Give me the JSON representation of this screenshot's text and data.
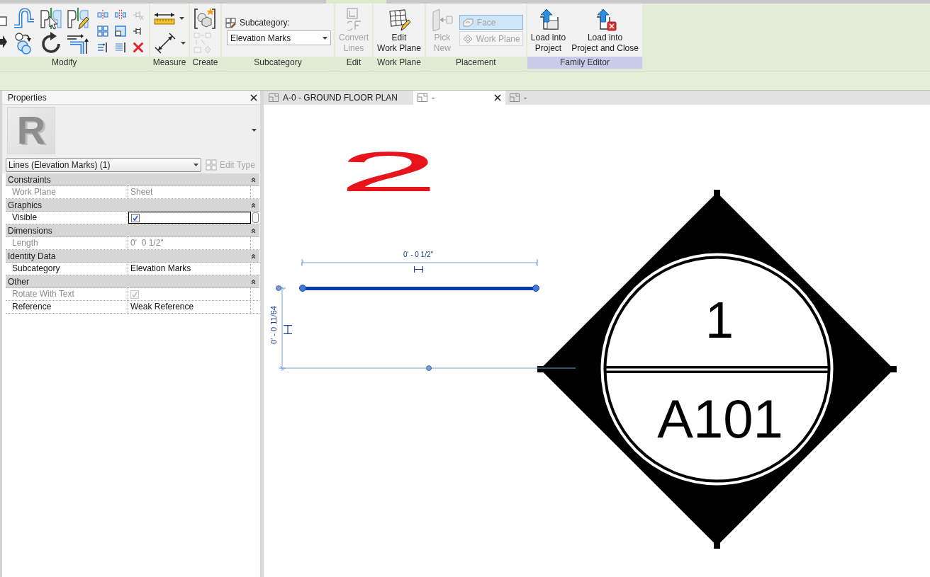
{
  "ribbon": {
    "panels": [
      {
        "kind": "modify",
        "label": "Modify",
        "highlighted": false,
        "large_tools": [
          {
            "kind": "align",
            "disabled": false
          },
          {
            "kind": "offset",
            "disabled": false
          },
          {
            "kind": "mirror_pick",
            "disabled": false
          },
          {
            "kind": "mirror_draw",
            "disabled": false
          },
          {
            "kind": "move",
            "disabled": false
          },
          {
            "kind": "copy",
            "disabled": false
          },
          {
            "kind": "rotate",
            "disabled": false
          },
          {
            "kind": "trim",
            "disabled": false
          }
        ],
        "small_tools": [
          {
            "kind": "split",
            "disabled": false
          },
          {
            "kind": "split_gap",
            "disabled": false
          },
          {
            "kind": "unpin",
            "disabled": true
          },
          {
            "kind": "array",
            "disabled": false
          },
          {
            "kind": "scale",
            "disabled": false
          },
          {
            "kind": "pin",
            "disabled": false
          },
          {
            "kind": "trim_multiple",
            "disabled": false
          },
          {
            "kind": "trim_single",
            "disabled": false
          },
          {
            "kind": "delete",
            "disabled": false
          }
        ]
      },
      {
        "kind": "measure",
        "label": "Measure",
        "highlighted": false,
        "tools": [
          {
            "kind": "aligned_dimension",
            "disabled": false
          },
          {
            "kind": "measure_between",
            "disabled": false
          }
        ]
      },
      {
        "kind": "create",
        "label": "Create",
        "highlighted": false,
        "tools": [
          {
            "kind": "group",
            "disabled": false
          },
          {
            "kind": "arrange",
            "disabled": true
          }
        ]
      },
      {
        "kind": "subcategory",
        "label": "Subcategory",
        "highlighted": false,
        "field_label": "Subcategory:",
        "value": "Elevation Marks"
      },
      {
        "kind": "buttons",
        "label": "Edit",
        "highlighted": false,
        "buttons": [
          {
            "kind": "convert_lines",
            "label": "Convert\nLines",
            "disabled": true
          }
        ]
      },
      {
        "kind": "buttons",
        "label": "Work Plane",
        "highlighted": false,
        "buttons": [
          {
            "kind": "edit_work_plane",
            "label": "Edit\nWork Plane",
            "disabled": false
          }
        ]
      },
      {
        "kind": "placement",
        "label": "Placement",
        "highlighted": false,
        "buttons": [
          {
            "kind": "pick_new",
            "label": "Pick\nNew",
            "disabled": true
          }
        ],
        "toggles": [
          {
            "kind": "face",
            "label": "Face",
            "selected": true,
            "disabled": true
          },
          {
            "kind": "work_plane",
            "label": "Work Plane",
            "selected": false,
            "disabled": true
          }
        ]
      },
      {
        "kind": "buttons",
        "label": "Family Editor",
        "highlighted": true,
        "buttons": [
          {
            "kind": "load",
            "label": "Load into\nProject",
            "disabled": false
          },
          {
            "kind": "load_close",
            "label": "Load into\nProject and Close",
            "disabled": false
          }
        ]
      }
    ]
  },
  "properties": {
    "title": "Properties",
    "logo": "R",
    "type_selector": "Lines (Elevation Marks) (1)",
    "edit_type": {
      "label": "Edit Type",
      "disabled": true
    },
    "groups": [
      {
        "name": "Constraints",
        "expanded": true,
        "rows": [
          {
            "kind": "text",
            "name": "Work Plane",
            "value": "Sheet",
            "disabled": true,
            "selected": false
          }
        ]
      },
      {
        "name": "Graphics",
        "expanded": true,
        "rows": [
          {
            "kind": "checkbox",
            "name": "Visible",
            "checked": true,
            "disabled": false,
            "selected": true
          }
        ]
      },
      {
        "name": "Dimensions",
        "expanded": true,
        "rows": [
          {
            "kind": "text",
            "name": "Length",
            "value": "0'  0 1/2\"",
            "disabled": true,
            "selected": false
          }
        ]
      },
      {
        "name": "Identity Data",
        "expanded": true,
        "rows": [
          {
            "kind": "text",
            "name": "Subcategory",
            "value": "Elevation Marks",
            "disabled": false,
            "selected": false
          }
        ]
      },
      {
        "name": "Other",
        "expanded": true,
        "rows": [
          {
            "kind": "checkbox",
            "name": "Rotate With Text",
            "checked": true,
            "disabled": true,
            "selected": false
          },
          {
            "kind": "text",
            "name": "Reference",
            "value": "Weak Reference",
            "disabled": false,
            "selected": false
          }
        ]
      }
    ]
  },
  "view_tabs": [
    {
      "label": "A-0 - GROUND FLOOR PLAN",
      "selected": false
    },
    {
      "label": "-",
      "selected": true
    },
    {
      "label": "-",
      "selected": false
    }
  ],
  "canvas": {
    "annotation": "2",
    "horizontal_dimension": "0' - 0 1/2\"",
    "vertical_dimension": "0' - 0 11/64",
    "marker": {
      "top_label": "1",
      "bottom_label": "A101"
    }
  }
}
